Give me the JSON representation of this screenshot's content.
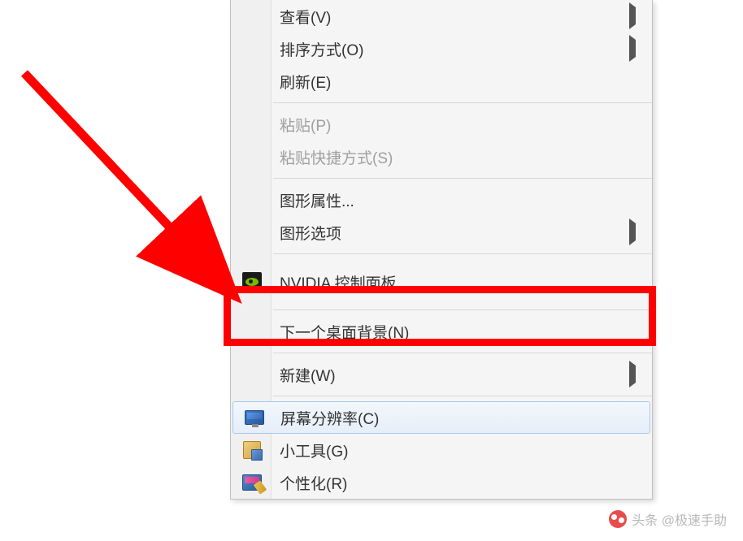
{
  "menu": {
    "view": "查看(V)",
    "sort": "排序方式(O)",
    "refresh": "刷新(E)",
    "paste": "粘贴(P)",
    "paste_shortcut": "粘贴快捷方式(S)",
    "graphics_properties": "图形属性...",
    "graphics_options": "图形选项",
    "nvidia_panel": "NVIDIA 控制面板",
    "next_background": "下一个桌面背景(N)",
    "new": "新建(W)",
    "screen_resolution": "屏幕分辨率(C)",
    "gadgets": "小工具(G)",
    "personalize": "个性化(R)"
  },
  "watermark": {
    "text": "头条 @极速手助"
  }
}
